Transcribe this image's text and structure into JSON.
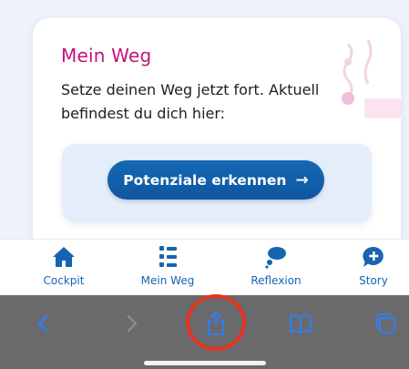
{
  "card": {
    "title": "Mein Weg",
    "text": "Setze deinen Weg jetzt fort. Aktuell befindest du dich hier:",
    "button_label": "Potenziale erkennen",
    "button_arrow": "→"
  },
  "tabs": [
    {
      "label": "Cockpit",
      "icon": "home-icon"
    },
    {
      "label": "Mein Weg",
      "icon": "path-icon"
    },
    {
      "label": "Reflexion",
      "icon": "thought-bubble-icon"
    },
    {
      "label": "Story",
      "icon": "chat-plus-icon"
    }
  ],
  "toolbar": {
    "items": [
      "back-icon",
      "forward-icon",
      "share-icon",
      "bookmarks-icon",
      "tabs-icon"
    ]
  },
  "colors": {
    "accent": "#1565b0",
    "title": "#c4127e",
    "highlight": "#e8321f",
    "toolbar": "#6a6a6c"
  }
}
